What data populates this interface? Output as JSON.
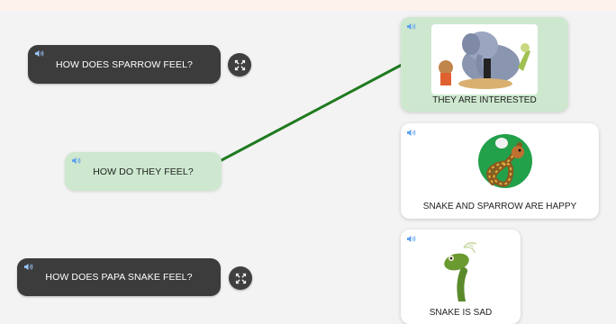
{
  "questions": [
    {
      "label": "HOW DOES SPARROW FEEL?"
    },
    {
      "label": "HOW DO THEY FEEL?"
    },
    {
      "label": "HOW DOES PAPA SNAKE FEEL?"
    }
  ],
  "answers": [
    {
      "label": "THEY ARE INTERESTED"
    },
    {
      "label": "SNAKE AND SPARROW ARE HAPPY"
    },
    {
      "label": "SNAKE IS SAD"
    }
  ],
  "icons": {
    "audio": "speaker-icon",
    "expand": "expand-icon"
  },
  "colors": {
    "connector": "#1f7a1f",
    "matched_fill": "#cde8cf",
    "dark_button": "#3c3c3c"
  }
}
